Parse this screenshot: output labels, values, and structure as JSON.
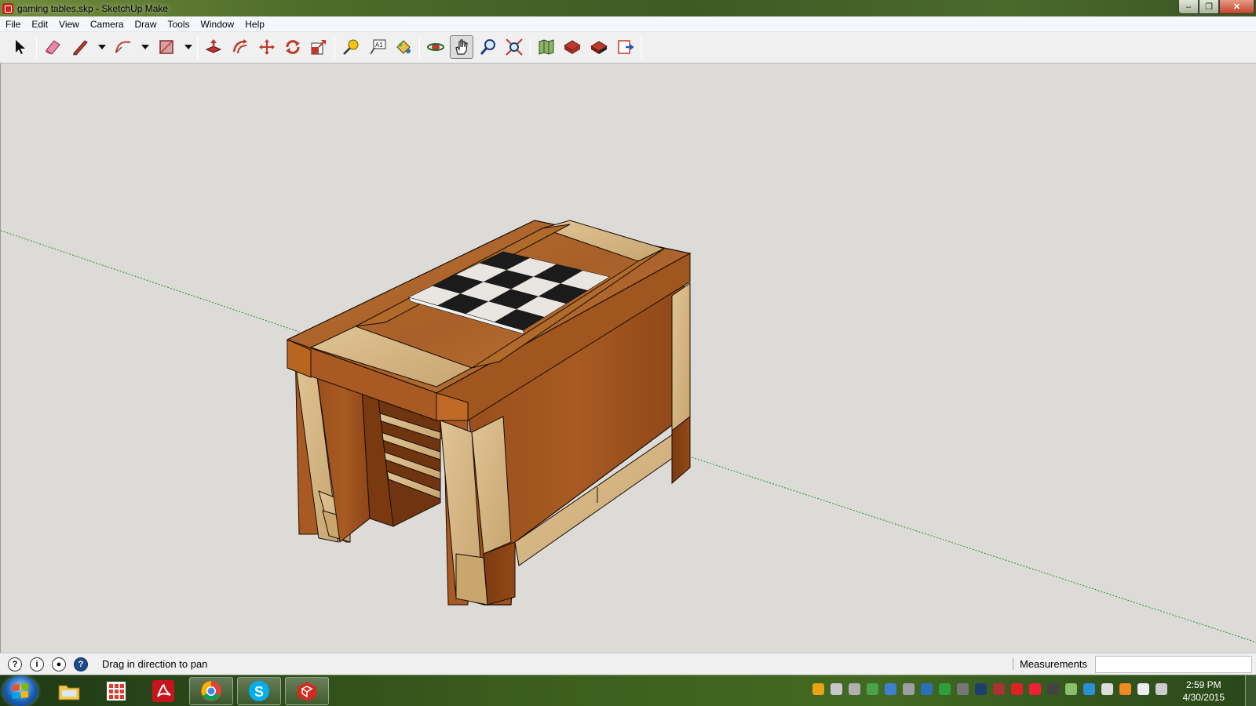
{
  "window": {
    "title": "gaming tables.skp - SketchUp Make",
    "controls": [
      "minimize",
      "maximize",
      "close"
    ]
  },
  "menu": [
    "File",
    "Edit",
    "View",
    "Camera",
    "Draw",
    "Tools",
    "Window",
    "Help"
  ],
  "toolbar": {
    "tools": [
      {
        "name": "select",
        "icon": "arrow-cursor-icon"
      },
      {
        "name": "eraser",
        "icon": "eraser-icon"
      },
      {
        "name": "line",
        "icon": "pencil-icon",
        "has_dropdown": true
      },
      {
        "name": "arc",
        "icon": "arc-icon",
        "has_dropdown": true
      },
      {
        "name": "rectangle",
        "icon": "rectangle-icon",
        "has_dropdown": true
      },
      {
        "name": "push-pull",
        "icon": "push-pull-icon"
      },
      {
        "name": "offset",
        "icon": "offset-icon"
      },
      {
        "name": "move",
        "icon": "move-icon"
      },
      {
        "name": "rotate",
        "icon": "rotate-icon"
      },
      {
        "name": "scale",
        "icon": "scale-icon"
      },
      {
        "name": "tape-measure",
        "icon": "tape-measure-icon"
      },
      {
        "name": "text",
        "icon": "text-icon"
      },
      {
        "name": "paint-bucket",
        "icon": "paint-bucket-icon"
      },
      {
        "name": "orbit",
        "icon": "orbit-icon"
      },
      {
        "name": "pan",
        "icon": "pan-hand-icon",
        "active": true
      },
      {
        "name": "zoom",
        "icon": "zoom-icon"
      },
      {
        "name": "zoom-extents",
        "icon": "zoom-extents-icon"
      },
      {
        "name": "add-location",
        "icon": "map-location-icon"
      },
      {
        "name": "3d-warehouse",
        "icon": "warehouse-icon"
      },
      {
        "name": "extension-warehouse",
        "icon": "extension-warehouse-icon"
      },
      {
        "name": "send-to-layout",
        "icon": "layout-icon"
      }
    ]
  },
  "status": {
    "hint": "Drag in direction to pan",
    "measurements_label": "Measurements",
    "measurements_value": "",
    "icons": [
      "geolocation-icon",
      "credits-icon",
      "user-icon",
      "instructor-help-icon"
    ]
  },
  "taskbar": {
    "apps": [
      {
        "name": "windows-explorer",
        "icon": "folder-icon"
      },
      {
        "name": "start-apps",
        "icon": "apps-grid-icon"
      },
      {
        "name": "adobe-reader",
        "icon": "adobe-reader-icon"
      },
      {
        "name": "chrome",
        "icon": "chrome-icon"
      },
      {
        "name": "skype",
        "icon": "skype-icon"
      },
      {
        "name": "sketchup",
        "icon": "sketchup-icon",
        "open": true
      }
    ],
    "clock": {
      "time": "2:59 PM",
      "date": "4/30/2015"
    }
  },
  "colors": {
    "viewport": "#dcdbd7",
    "wood_dark": "#8b4513",
    "wood_light": "#c8a070",
    "axis_green": "#2e8b2e",
    "title_bar": "#4e6b2a"
  }
}
